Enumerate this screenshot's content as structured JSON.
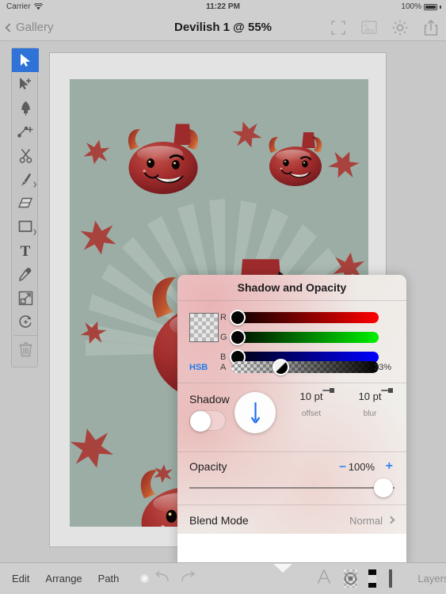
{
  "status_bar": {
    "carrier": "Carrier",
    "wifi_icon": "wifi-icon",
    "time": "11:22 PM",
    "battery_percent": "100%"
  },
  "nav_bar": {
    "back_label": "Gallery",
    "title": "Devilish 1 @ 55%",
    "icons": [
      {
        "name": "fit-to-screen-icon"
      },
      {
        "name": "image-icon"
      },
      {
        "name": "settings-gear-icon"
      },
      {
        "name": "share-export-icon"
      }
    ]
  },
  "tools": [
    {
      "name": "select-tool",
      "selected": true,
      "caret": false
    },
    {
      "name": "direct-select-tool",
      "selected": false,
      "caret": false
    },
    {
      "name": "pen-tool",
      "selected": false,
      "caret": false
    },
    {
      "name": "add-node-tool",
      "selected": false,
      "caret": false
    },
    {
      "name": "scissors-tool",
      "selected": false,
      "caret": false
    },
    {
      "name": "brush-tool",
      "selected": false,
      "caret": true
    },
    {
      "name": "eraser-tool",
      "selected": false,
      "caret": false
    },
    {
      "name": "rectangle-tool",
      "selected": false,
      "caret": true
    },
    {
      "name": "text-tool",
      "selected": false,
      "caret": false
    },
    {
      "name": "eyedropper-tool",
      "selected": false,
      "caret": false
    },
    {
      "name": "transform-tool",
      "selected": false,
      "caret": false
    },
    {
      "name": "rotate-tool",
      "selected": false,
      "caret": false
    },
    {
      "name": "delete-tool",
      "selected": false,
      "caret": false
    }
  ],
  "popup": {
    "title": "Shadow and Opacity",
    "color": {
      "swatch_name": "transparent-color-swatch",
      "mode_toggle_label": "HSB",
      "channels": [
        {
          "label": "R",
          "value": "0",
          "percent": 0
        },
        {
          "label": "G",
          "value": "0",
          "percent": 0
        },
        {
          "label": "B",
          "value": "0",
          "percent": 0
        }
      ],
      "alpha": {
        "label": "A",
        "value": "33%",
        "percent": 33
      }
    },
    "shadow": {
      "label": "Shadow",
      "enabled": false,
      "direction_icon": "arrow-down-icon",
      "offset": {
        "value": "10 pt",
        "caption": "offset",
        "percent": 18
      },
      "blur": {
        "value": "10 pt",
        "caption": "blur",
        "percent": 18
      }
    },
    "opacity": {
      "label": "Opacity",
      "minus_label": "−",
      "plus_label": "+",
      "value": "100%",
      "percent": 100
    },
    "blend_mode": {
      "label": "Blend Mode",
      "value": "Normal"
    }
  },
  "bottom_bar": {
    "edit_label": "Edit",
    "arrange_label": "Arrange",
    "path_label": "Path",
    "color_wheel_name": "color-wheel-icon",
    "undo_name": "undo-icon",
    "redo_name": "redo-icon",
    "text_style_name": "text-style-icon",
    "shadow_opacity_name": "shadow-opacity-icon",
    "fill_name": "fill-swatch-icon",
    "stroke_name": "stroke-swatch-icon",
    "palette_name": "palette-icon",
    "layers_label": "Layers"
  },
  "artwork": {
    "background_color": "#9bada5",
    "devil_red": "#a8302e",
    "star_color": "#a8423c",
    "page_color": "#e3e3e3"
  },
  "theme": {
    "accent_blue": "#2f73d8",
    "link_blue": "#1f7bf0",
    "chrome_gray": "#cfcfcf"
  }
}
